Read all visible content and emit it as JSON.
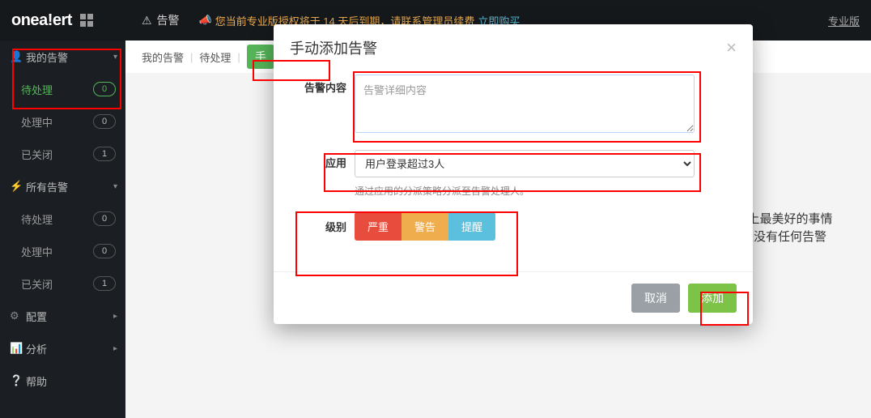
{
  "topbar": {
    "brand_pre": "one",
    "brand_mid": "a",
    "brand_post": "ert",
    "alarm_label": "告警",
    "announce_text": "您当前专业版授权将于 14 天后到期，请联系管理员续费",
    "announce_buy": "立即购买",
    "pro_label": "专业版"
  },
  "sidebar": {
    "groups": [
      {
        "icon": "user-icon",
        "title": "我的告警",
        "items": [
          {
            "label": "待处理",
            "count": "0",
            "active": true
          },
          {
            "label": "处理中",
            "count": "0"
          },
          {
            "label": "已关闭",
            "count": "1"
          }
        ]
      },
      {
        "icon": "bolt-icon",
        "title": "所有告警",
        "items": [
          {
            "label": "待处理",
            "count": "0"
          },
          {
            "label": "处理中",
            "count": "0"
          },
          {
            "label": "已关闭",
            "count": "1"
          }
        ]
      },
      {
        "icon": "gear-icon",
        "title": "配置"
      },
      {
        "icon": "chart-icon",
        "title": "分析"
      },
      {
        "icon": "help-icon",
        "title": "帮助"
      }
    ]
  },
  "breadcrumb": {
    "a": "我的告警",
    "b": "待处理",
    "btn": "手"
  },
  "placeholder": {
    "line1": "世界上最美好的事情",
    "line2": "就是没有任何告警"
  },
  "modal": {
    "title": "手动添加告警",
    "content_label": "告警内容",
    "content_placeholder": "告警详细内容",
    "app_label": "应用",
    "app_selected": "用户登录超过3人",
    "app_help": "通过应用的分派策略分派至告警处理人。",
    "level_label": "级别",
    "levels": {
      "critical": "严重",
      "warning": "警告",
      "info": "提醒"
    },
    "cancel": "取消",
    "submit": "添加"
  }
}
